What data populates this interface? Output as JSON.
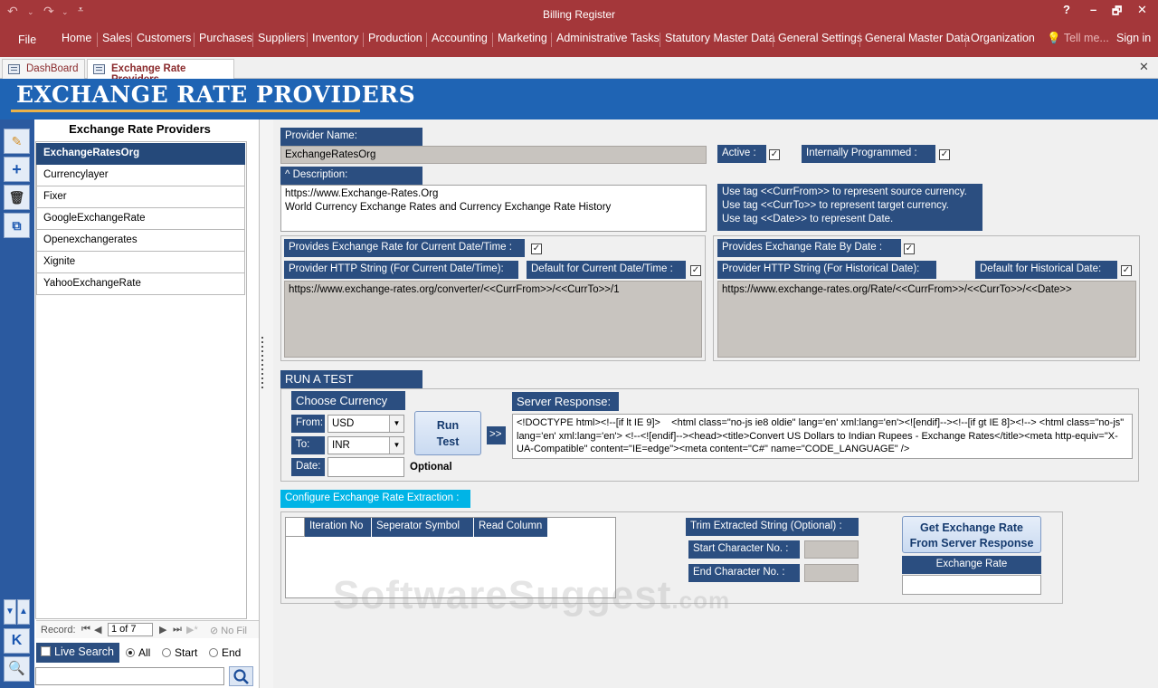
{
  "app": {
    "title": "Billing Register",
    "minimize": "–",
    "help": "?",
    "restore": "🗗",
    "close": "✕"
  },
  "menu": {
    "items": [
      "File",
      "Home",
      "Sales",
      "Customers",
      "Purchases",
      "Suppliers",
      "Inventory",
      "Production",
      "Accounting",
      "Marketing",
      "Administrative Tasks",
      "Statutory Master Data",
      "General Settings",
      "General Master Data",
      "Organization"
    ],
    "tell_me": "Tell me...",
    "sign_in": "Sign in"
  },
  "tabs": [
    {
      "label": "DashBoard"
    },
    {
      "label": "Exchange Rate Providers"
    }
  ],
  "header": {
    "title": "EXCHANGE RATE PROVIDERS"
  },
  "list": {
    "title": "Exchange Rate Providers",
    "items": [
      "ExchangeRatesOrg",
      "Currencylayer",
      "Fixer",
      "GoogleExchangeRate",
      "Openexchangerates",
      "Xignite",
      "YahooExchangeRate"
    ],
    "selected_index": 0,
    "record_label": "Record:",
    "record_pos": "1 of 7",
    "no_filter": "No Fil"
  },
  "search": {
    "live_search": "Live Search",
    "options": [
      "All",
      "Start",
      "End"
    ],
    "selected": "All"
  },
  "form": {
    "provider_name_label": "Provider Name:",
    "provider_name": "ExchangeRatesOrg",
    "active_label": "Active :",
    "internal_label": "Internally Programmed :",
    "description_label": "^ Description:",
    "description": "https://www.Exchange-Rates.Org\nWorld Currency Exchange Rates and Currency Exchange Rate History",
    "tag_help": "Use tag <<CurrFrom>> to represent source currency.\nUse tag <<CurrTo>> to represent target currency.\nUse tag <<Date>> to represent Date.",
    "current_rate_label": "Provides Exchange Rate for Current Date/Time :",
    "current_http_label": "Provider HTTP String (For Current Date/Time):",
    "current_default_label": "Default for Current Date/Time :",
    "current_http": "https://www.exchange-rates.org/converter/<<CurrFrom>>/<<CurrTo>>/1",
    "bydate_label": "Provides Exchange Rate By Date :",
    "hist_http_label": "Provider HTTP String (For Historical Date):",
    "hist_default_label": "Default for Historical Date:",
    "hist_http": "https://www.exchange-rates.org/Rate/<<CurrFrom>>/<<CurrTo>>/<<Date>>"
  },
  "test": {
    "section_label": "RUN A TEST",
    "choose_currency": "Choose Currency",
    "from_label": "From:",
    "from_value": "USD",
    "to_label": "To:",
    "to_value": "INR",
    "date_label": "Date:",
    "optional": "Optional",
    "run_button": "Run\nTest",
    "arrow": ">>",
    "server_response_label": "Server Response:",
    "server_response": "<!DOCTYPE html><!--[if lt IE 9]>    <html class=\"no-js ie8 oldie\" lang='en' xml:lang='en'><![endif]--><!--[if gt IE 8]><!--> <html class=\"no-js\" lang='en' xml:lang='en'> <!--<![endif]--><head><title>Convert US Dollars to Indian Rupees - Exchange Rates</title><meta http-equiv=\"X-UA-Compatible\" content=\"IE=edge\"><meta content=\"C#\" name=\"CODE_LANGUAGE\" />"
  },
  "extraction": {
    "section_label": "Configure Exchange Rate Extraction :",
    "columns": [
      "Iteration No",
      "Seperator Symbol",
      "Read Column"
    ],
    "trim_label": "Trim Extracted String (Optional) :",
    "start_label": "Start Character No. :",
    "end_label": "End Character No. :",
    "get_button": "Get Exchange Rate\nFrom Server Response",
    "rate_label": "Exchange Rate"
  },
  "watermark": {
    "main": "SoftwareSuggest",
    "suffix": ".com"
  },
  "colors": {
    "ribbon": "#a4373a",
    "banner": "#1f64b4",
    "label_bg": "#2b4e80",
    "selection": "#25497a",
    "section_cyan": "#00b4e6"
  }
}
